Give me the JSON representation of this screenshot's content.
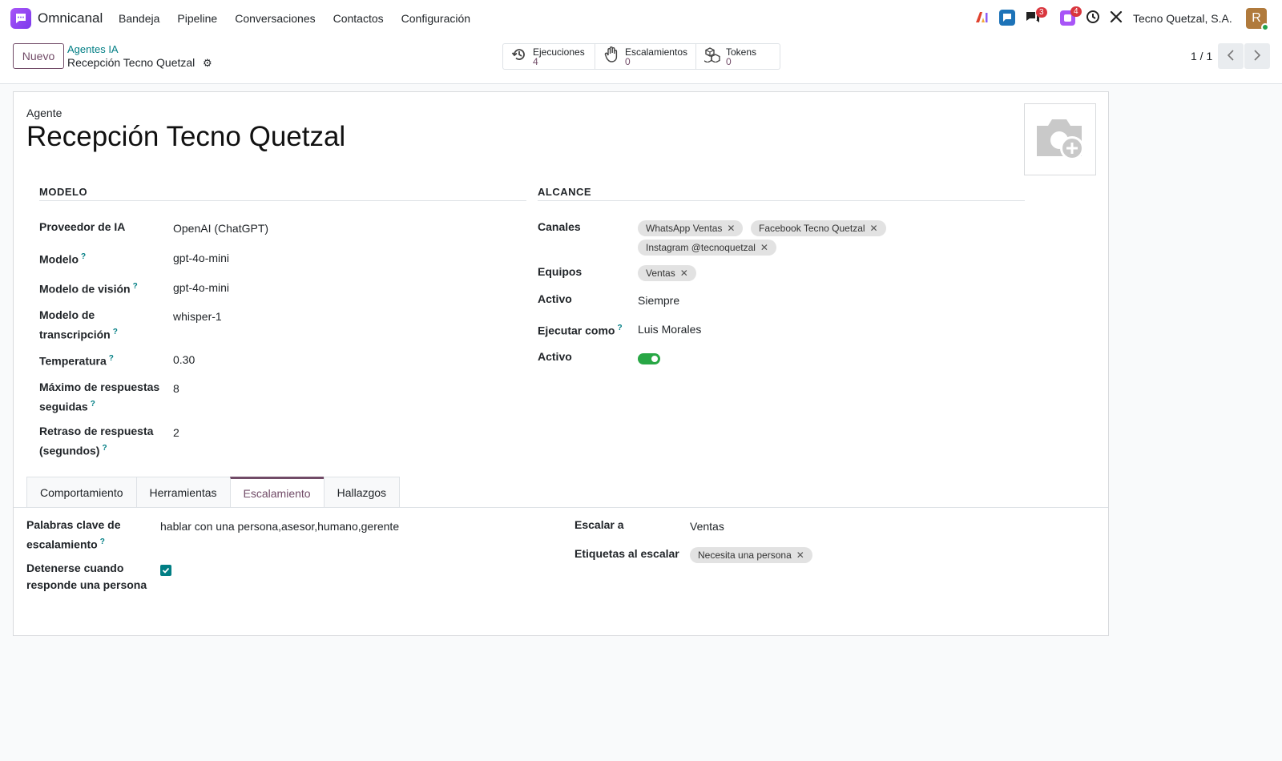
{
  "navbar": {
    "app_name": "Omnicanal",
    "menu": [
      "Bandeja",
      "Pipeline",
      "Conversaciones",
      "Contactos",
      "Configuración"
    ],
    "messages_badge": "3",
    "activity_badge": "4",
    "company": "Tecno Quetzal, S.A.",
    "avatar_initial": "R"
  },
  "control": {
    "new_button": "Nuevo",
    "breadcrumb_parent": "Agentes IA",
    "breadcrumb_current": "Recepción Tecno Quetzal",
    "stats": [
      {
        "label": "Ejecuciones",
        "value": "4",
        "icon": "history-icon"
      },
      {
        "label": "Escalamientos",
        "value": "0",
        "icon": "hand-icon"
      },
      {
        "label": "Tokens",
        "value": "0",
        "icon": "cubes-icon"
      }
    ],
    "pager": "1 / 1"
  },
  "form": {
    "agent_label": "Agente",
    "title": "Recepción Tecno Quetzal",
    "model_section": "MODELO",
    "scope_section": "ALCANCE",
    "model_fields": {
      "provider_label": "Proveedor de IA",
      "provider_value": "OpenAI (ChatGPT)",
      "model_label": "Modelo",
      "model_value": "gpt-4o-mini",
      "vision_label": "Modelo de visión",
      "vision_value": "gpt-4o-mini",
      "transcription_label_1": "Modelo de",
      "transcription_label_2": "transcripción",
      "transcription_value": "whisper-1",
      "temperature_label": "Temperatura",
      "temperature_value": "0.30",
      "max_replies_label_1": "Máximo de respuestas",
      "max_replies_label_2": "seguidas",
      "max_replies_value": "8",
      "delay_label_1": "Retraso de respuesta",
      "delay_label_2": "(segundos)",
      "delay_value": "2"
    },
    "scope_fields": {
      "channels_label": "Canales",
      "channels": [
        "WhatsApp Ventas",
        "Facebook Tecno Quetzal",
        "Instagram @tecnoquetzal"
      ],
      "teams_label": "Equipos",
      "teams": [
        "Ventas"
      ],
      "active_label": "Activo",
      "active_value": "Siempre",
      "run_as_label": "Ejecutar como",
      "run_as_value": "Luis Morales",
      "enabled_label": "Activo",
      "enabled": true
    },
    "tabs": [
      "Comportamiento",
      "Herramientas",
      "Escalamiento",
      "Hallazgos"
    ],
    "active_tab": "Escalamiento",
    "escalation": {
      "keywords_label_1": "Palabras clave de",
      "keywords_label_2": "escalamiento",
      "keywords_value": "hablar con una persona,asesor,humano,gerente",
      "stop_label_1": "Detenerse cuando",
      "stop_label_2": "responde una persona",
      "stop_checked": true,
      "escalate_to_label": "Escalar a",
      "escalate_to_value": "Ventas",
      "tags_label": "Etiquetas al escalar",
      "tags": [
        "Necesita una persona"
      ]
    }
  },
  "colors": {
    "primary": "#714b67",
    "link": "#017e84",
    "badge": "#d9363e",
    "toggle_on": "#28a745"
  }
}
